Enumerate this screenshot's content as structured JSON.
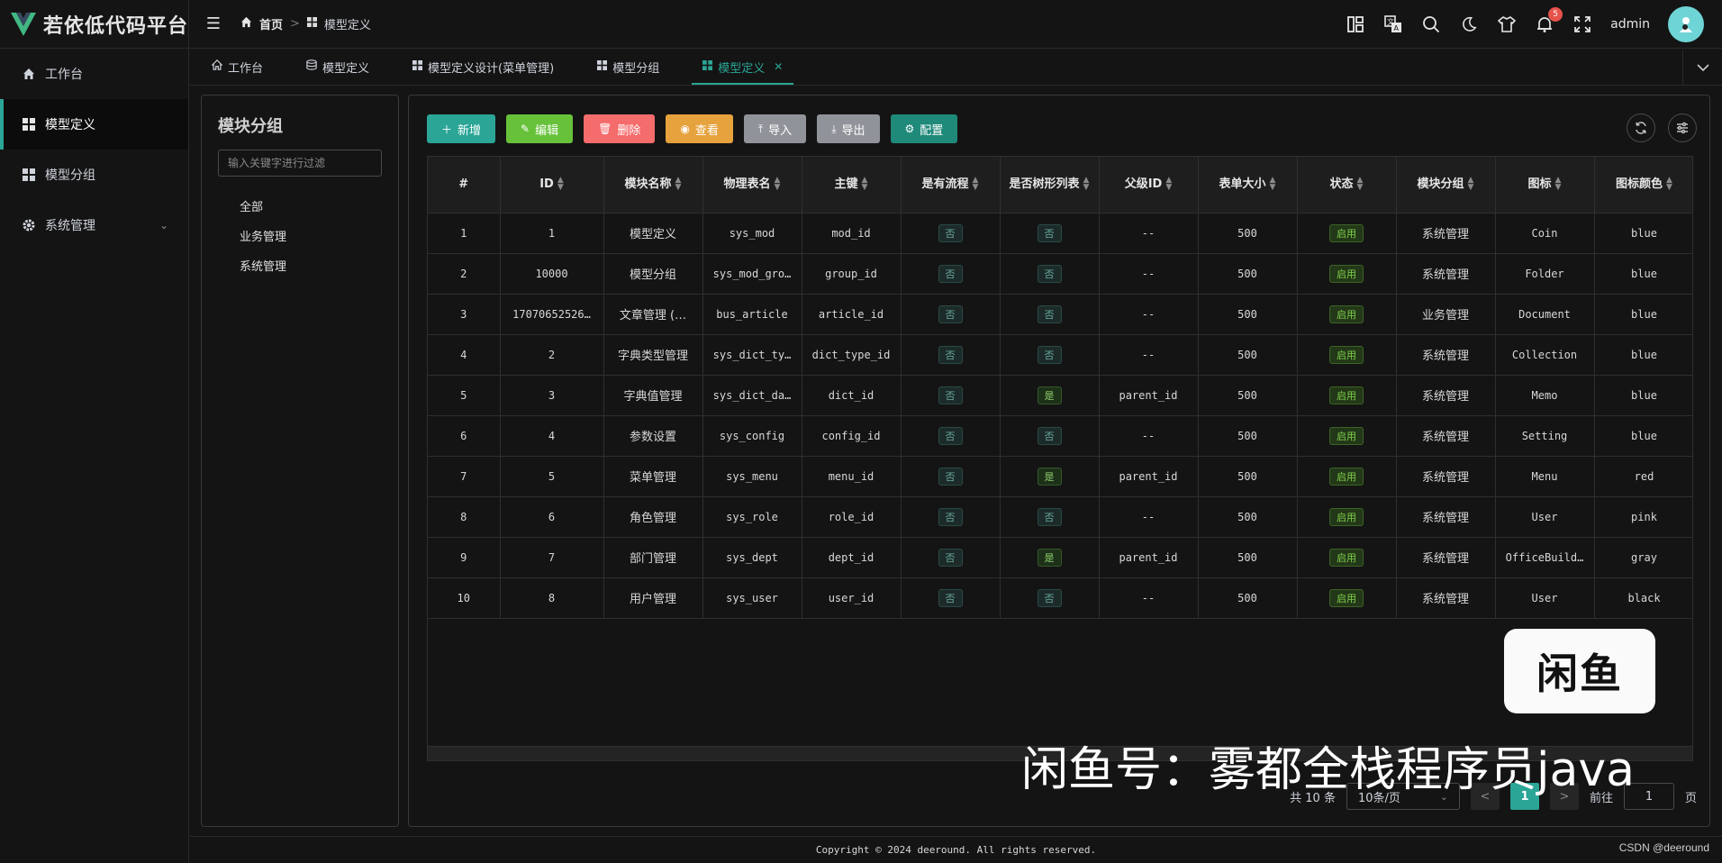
{
  "app": {
    "title": "若依低代码平台"
  },
  "sidebar": {
    "items": [
      {
        "label": "工作台",
        "icon": "home-icon"
      },
      {
        "label": "模型定义",
        "icon": "grid-icon",
        "active": true
      },
      {
        "label": "模型分组",
        "icon": "grid-icon"
      },
      {
        "label": "系统管理",
        "icon": "gear-icon"
      }
    ]
  },
  "header": {
    "breadcrumb": {
      "home": "首页",
      "current": "模型定义"
    },
    "username": "admin",
    "notification_count": "5"
  },
  "tabs": [
    {
      "label": "工作台",
      "icon": "home-icon"
    },
    {
      "label": "模型定义",
      "icon": "layers-icon"
    },
    {
      "label": "模型定义设计(菜单管理)",
      "icon": "grid-icon"
    },
    {
      "label": "模型分组",
      "icon": "grid-icon"
    },
    {
      "label": "模型定义",
      "icon": "grid-icon",
      "active": true
    }
  ],
  "group_panel": {
    "title": "模块分组",
    "filter_placeholder": "输入关键字进行过滤",
    "nodes": [
      "全部",
      "业务管理",
      "系统管理"
    ]
  },
  "toolbar": {
    "add": "新增",
    "edit": "编辑",
    "delete": "删除",
    "view": "查看",
    "import": "导入",
    "export": "导出",
    "config": "配置"
  },
  "table": {
    "headers": [
      "#",
      "ID",
      "模块名称",
      "物理表名",
      "主键",
      "是有流程",
      "是否树形列表",
      "父级ID",
      "表单大小",
      "状态",
      "模块分组",
      "图标",
      "图标颜色"
    ],
    "rows": [
      [
        "1",
        "1",
        "模型定义",
        "sys_mod",
        "mod_id",
        "否",
        "否",
        "--",
        "500",
        "启用",
        "系统管理",
        "Coin",
        "blue"
      ],
      [
        "2",
        "10000",
        "模型分组",
        "sys_mod_gro…",
        "group_id",
        "否",
        "否",
        "--",
        "500",
        "启用",
        "系统管理",
        "Folder",
        "blue"
      ],
      [
        "3",
        "17070652526…",
        "文章管理 (…",
        "bus_article",
        "article_id",
        "否",
        "否",
        "--",
        "500",
        "启用",
        "业务管理",
        "Document",
        "blue"
      ],
      [
        "4",
        "2",
        "字典类型管理",
        "sys_dict_ty…",
        "dict_type_id",
        "否",
        "否",
        "--",
        "500",
        "启用",
        "系统管理",
        "Collection",
        "blue"
      ],
      [
        "5",
        "3",
        "字典值管理",
        "sys_dict_da…",
        "dict_id",
        "否",
        "是",
        "parent_id",
        "500",
        "启用",
        "系统管理",
        "Memo",
        "blue"
      ],
      [
        "6",
        "4",
        "参数设置",
        "sys_config",
        "config_id",
        "否",
        "否",
        "--",
        "500",
        "启用",
        "系统管理",
        "Setting",
        "blue"
      ],
      [
        "7",
        "5",
        "菜单管理",
        "sys_menu",
        "menu_id",
        "否",
        "是",
        "parent_id",
        "500",
        "启用",
        "系统管理",
        "Menu",
        "red"
      ],
      [
        "8",
        "6",
        "角色管理",
        "sys_role",
        "role_id",
        "否",
        "否",
        "--",
        "500",
        "启用",
        "系统管理",
        "User",
        "pink"
      ],
      [
        "9",
        "7",
        "部门管理",
        "sys_dept",
        "dept_id",
        "否",
        "是",
        "parent_id",
        "500",
        "启用",
        "系统管理",
        "OfficeBuild…",
        "gray"
      ],
      [
        "10",
        "8",
        "用户管理",
        "sys_user",
        "user_id",
        "否",
        "否",
        "--",
        "500",
        "启用",
        "系统管理",
        "User",
        "black"
      ]
    ]
  },
  "pagination": {
    "total": "共 10 条",
    "page_size": "10条/页",
    "current_page": "1",
    "goto_label": "前往",
    "goto_value": "1",
    "page_suffix": "页"
  },
  "footer": {
    "copyright": "Copyright © 2024 deeround. All rights reserved."
  },
  "watermark": {
    "logo_text": "闲鱼",
    "text": "闲鱼号：雾都全栈程序员java",
    "csdn": "CSDN @deeround"
  },
  "colors": {
    "accent": "#2ba596",
    "success": "#67c23a",
    "danger": "#f56c6c",
    "warning": "#e6a23c",
    "info": "#909399"
  }
}
